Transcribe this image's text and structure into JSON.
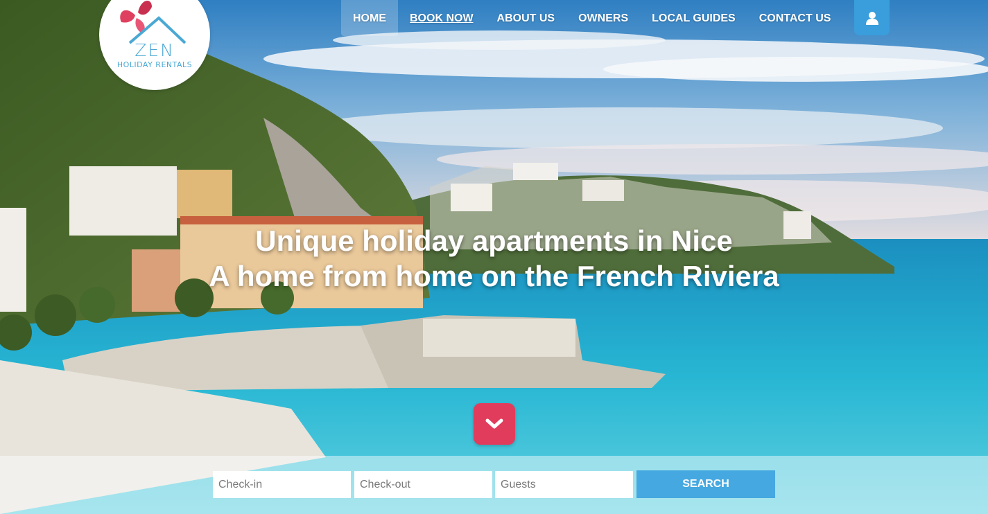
{
  "brand": {
    "name": "ZEN",
    "tagline": "HOLIDAY RENTALS"
  },
  "nav": {
    "items": [
      {
        "label": "HOME",
        "active": true
      },
      {
        "label": "BOOK NOW",
        "active": false
      },
      {
        "label": "ABOUT US",
        "active": false
      },
      {
        "label": "OWNERS",
        "active": false
      },
      {
        "label": "LOCAL GUIDES",
        "active": false
      },
      {
        "label": "CONTACT US",
        "active": false
      }
    ],
    "user_icon": "user-icon"
  },
  "hero": {
    "line1": "Unique holiday apartments in Nice",
    "line2": "A home from home on the French Riviera"
  },
  "scroll_icon": "chevron-down-icon",
  "search": {
    "checkin_placeholder": "Check-in",
    "checkout_placeholder": "Check-out",
    "guests_placeholder": "Guests",
    "button_label": "SEARCH"
  },
  "colors": {
    "accent_blue": "#45a8e0",
    "scroll_button": "#e23c5d",
    "logo_text": "#4aa8d4",
    "logo_petal": "#e0405f"
  }
}
